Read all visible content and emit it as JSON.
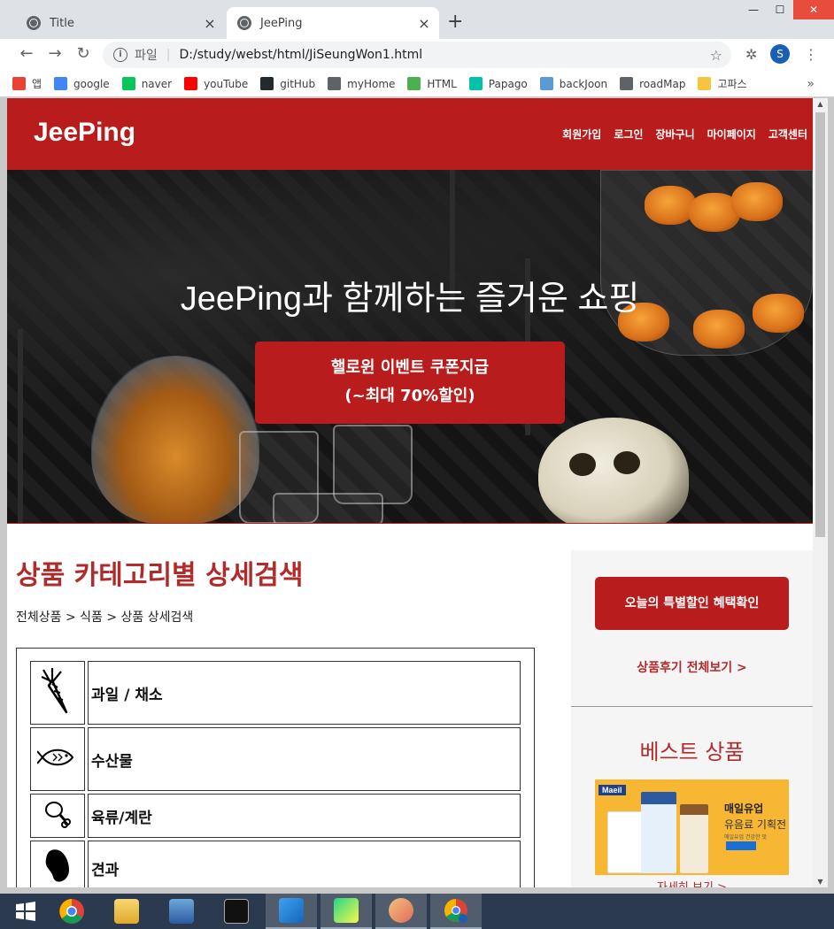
{
  "browser": {
    "tabs": [
      {
        "title": "Title"
      },
      {
        "title": "JeePing"
      }
    ],
    "close_glyph": "×",
    "new_tab_glyph": "+",
    "window_controls": {
      "minimize": "—",
      "maximize": "☐",
      "close": "✕"
    },
    "address": {
      "scheme_label": "파일",
      "url": "D:/study/webst/html/JiSeungWon1.html"
    },
    "profile_initial": "S",
    "bookmarks": [
      {
        "label": "앱",
        "icon": "apps-grid-icon",
        "color": "#e94235"
      },
      {
        "label": "google",
        "icon": "google-icon",
        "color": "#4285f4"
      },
      {
        "label": "naver",
        "icon": "naver-icon",
        "color": "#03c75a"
      },
      {
        "label": "youTube",
        "icon": "youtube-icon",
        "color": "#ff0000"
      },
      {
        "label": "gitHub",
        "icon": "github-icon",
        "color": "#24292e"
      },
      {
        "label": "myHome",
        "icon": "globe-icon",
        "color": "#5f6368"
      },
      {
        "label": "HTML",
        "icon": "w3-icon",
        "color": "#4caf50"
      },
      {
        "label": "Papago",
        "icon": "papago-icon",
        "color": "#00c2a8"
      },
      {
        "label": "backJoon",
        "icon": "code-icon",
        "color": "#5b9bd5"
      },
      {
        "label": "roadMap",
        "icon": "globe-icon",
        "color": "#5f6368"
      },
      {
        "label": "고파스",
        "icon": "tiger-icon",
        "color": "#f5c542"
      }
    ],
    "bookmarks_more": "»"
  },
  "site": {
    "logo": "JeePing",
    "nav": [
      "회원가입",
      "로그인",
      "장바구니",
      "마이페이지",
      "고객센터"
    ],
    "hero": {
      "title": "JeePing과 함께하는 즐거운 쇼핑",
      "button_line1": "핼로윈 이벤트 쿠폰지급",
      "button_line2": "(~최대 70%할인)"
    },
    "main": {
      "heading": "상품 카테고리별 상세검색",
      "breadcrumb": "전체상품 > 식품 > 상품 상세검색",
      "categories": [
        {
          "label": "과일 / 채소",
          "icon": "carrot-icon"
        },
        {
          "label": "수산물",
          "icon": "fish-icon"
        },
        {
          "label": "육류/계란",
          "icon": "drumstick-icon"
        },
        {
          "label": "견과",
          "icon": "bean-icon"
        }
      ]
    },
    "aside": {
      "special_button": "오늘의 특별할인 혜택확인",
      "review_link": "상품후기 전체보기 >",
      "best_title": "베스트 상품",
      "banner": {
        "brand": "Maeil",
        "line1": "매일유업",
        "line2": "유음료 기획전",
        "line3": "매일유업 건강한 맛"
      },
      "detail_link": "자세히 보기 >"
    }
  },
  "colors": {
    "brand_red": "#b91c1c",
    "heading_red": "#b22b2b"
  },
  "taskbar": [
    "windows-start-icon",
    "chrome-icon",
    "file-explorer-icon",
    "remote-desktop-icon",
    "terminal-icon",
    "vscode-icon",
    "pycharm-icon",
    "paint-icon",
    "chrome-profile-icon"
  ]
}
